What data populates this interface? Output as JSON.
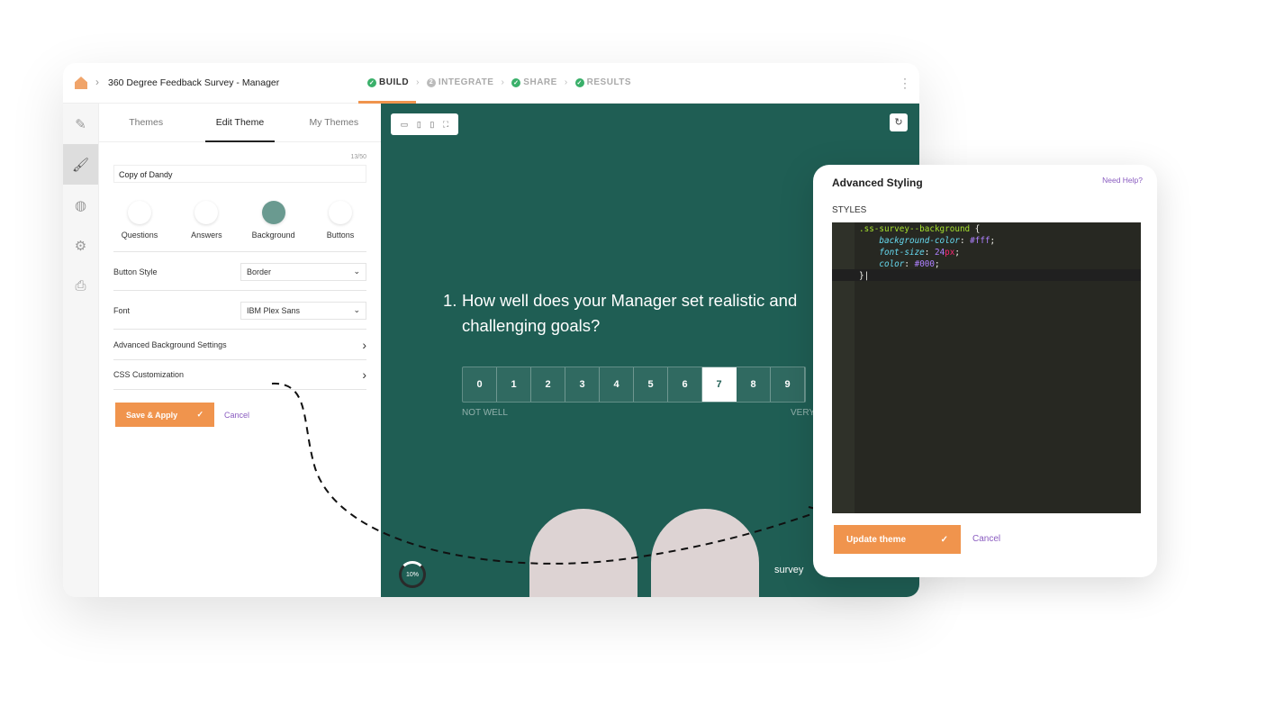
{
  "header": {
    "title": "360 Degree Feedback Survey - Manager",
    "steps": [
      {
        "label": "BUILD",
        "state": "done"
      },
      {
        "label": "INTEGRATE",
        "state": "2"
      },
      {
        "label": "SHARE",
        "state": "done"
      },
      {
        "label": "RESULTS",
        "state": "done"
      }
    ]
  },
  "rail": {
    "icons": [
      "pencil-icon",
      "paintbrush-icon",
      "globe-icon",
      "gear-icon",
      "printer-icon"
    ],
    "active": 1
  },
  "panel": {
    "tabs": [
      "Themes",
      "Edit Theme",
      "My Themes"
    ],
    "active_tab": "Edit Theme",
    "char_count": "13/50",
    "theme_name": "Copy of Dandy",
    "swatches": [
      {
        "label": "Questions",
        "color": "#ffffff"
      },
      {
        "label": "Answers",
        "color": "#ffffff"
      },
      {
        "label": "Background",
        "color": "#6a9a90"
      },
      {
        "label": "Buttons",
        "color": "#ffffff"
      }
    ],
    "button_style_label": "Button Style",
    "button_style_value": "Border",
    "font_label": "Font",
    "font_value": "IBM Plex Sans",
    "advanced_bg": "Advanced Background Settings",
    "css_custom": "CSS Customization",
    "save": "Save & Apply",
    "cancel": "Cancel"
  },
  "survey": {
    "question_number": "1.",
    "question": "How well does your Manager set realistic and challenging goals?",
    "scale": [
      "0",
      "1",
      "2",
      "3",
      "4",
      "5",
      "6",
      "7",
      "8",
      "9"
    ],
    "selected": "7",
    "low_label": "NOT WELL",
    "high_label": "VERY",
    "progress": "10%",
    "brand": "survey"
  },
  "modal": {
    "title": "Advanced Styling",
    "help": "Need Help?",
    "styles_label": "STYLES",
    "selector": ".ss-survey--background",
    "props": [
      {
        "name": "background-color",
        "value": "#fff"
      },
      {
        "name": "font-size",
        "value": "24",
        "unit": "px"
      },
      {
        "name": "color",
        "value": "#000"
      }
    ],
    "update": "Update theme",
    "cancel": "Cancel"
  },
  "colors": {
    "accent": "#f0944d",
    "survey_bg": "#1f5e54",
    "link": "#8a5cc0",
    "check": "#3ab06a"
  }
}
